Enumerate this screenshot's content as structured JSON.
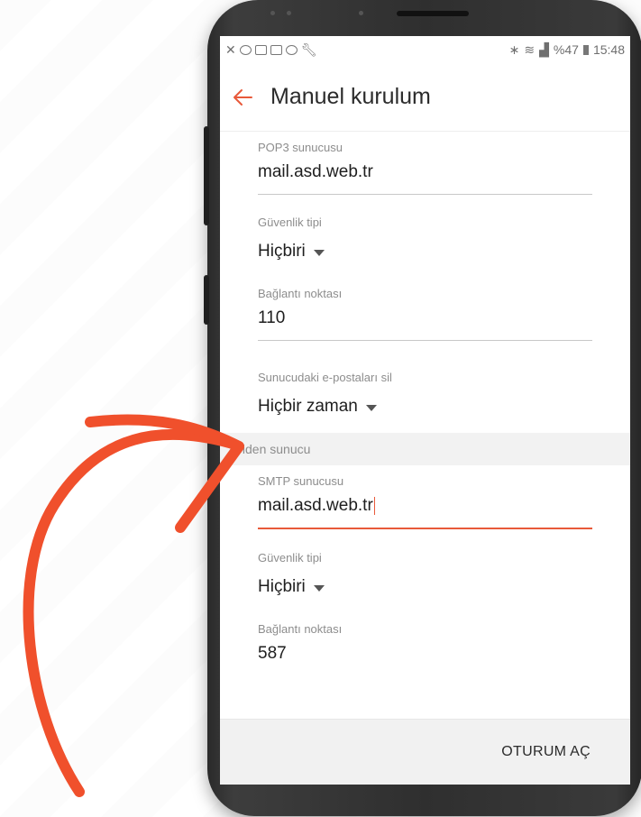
{
  "status_bar": {
    "battery": "%47",
    "time": "15:48"
  },
  "header": {
    "title": "Manuel kurulum"
  },
  "incoming": {
    "server_label": "POP3 sunucusu",
    "server_value": "mail.asd.web.tr",
    "security_label": "Güvenlik tipi",
    "security_value": "Hiçbiri",
    "port_label": "Bağlantı noktası",
    "port_value": "110",
    "delete_label": "Sunucudaki e-postaları sil",
    "delete_value": "Hiçbir zaman"
  },
  "outgoing": {
    "section_title": "Giden sunucu",
    "server_label": "SMTP sunucusu",
    "server_value": "mail.asd.web.tr",
    "security_label": "Güvenlik tipi",
    "security_value": "Hiçbiri",
    "port_label": "Bağlantı noktası",
    "port_value": "587"
  },
  "footer": {
    "signin_label": "OTURUM AÇ"
  },
  "colors": {
    "accent": "#e8593a",
    "arrow": "#f0502c"
  }
}
